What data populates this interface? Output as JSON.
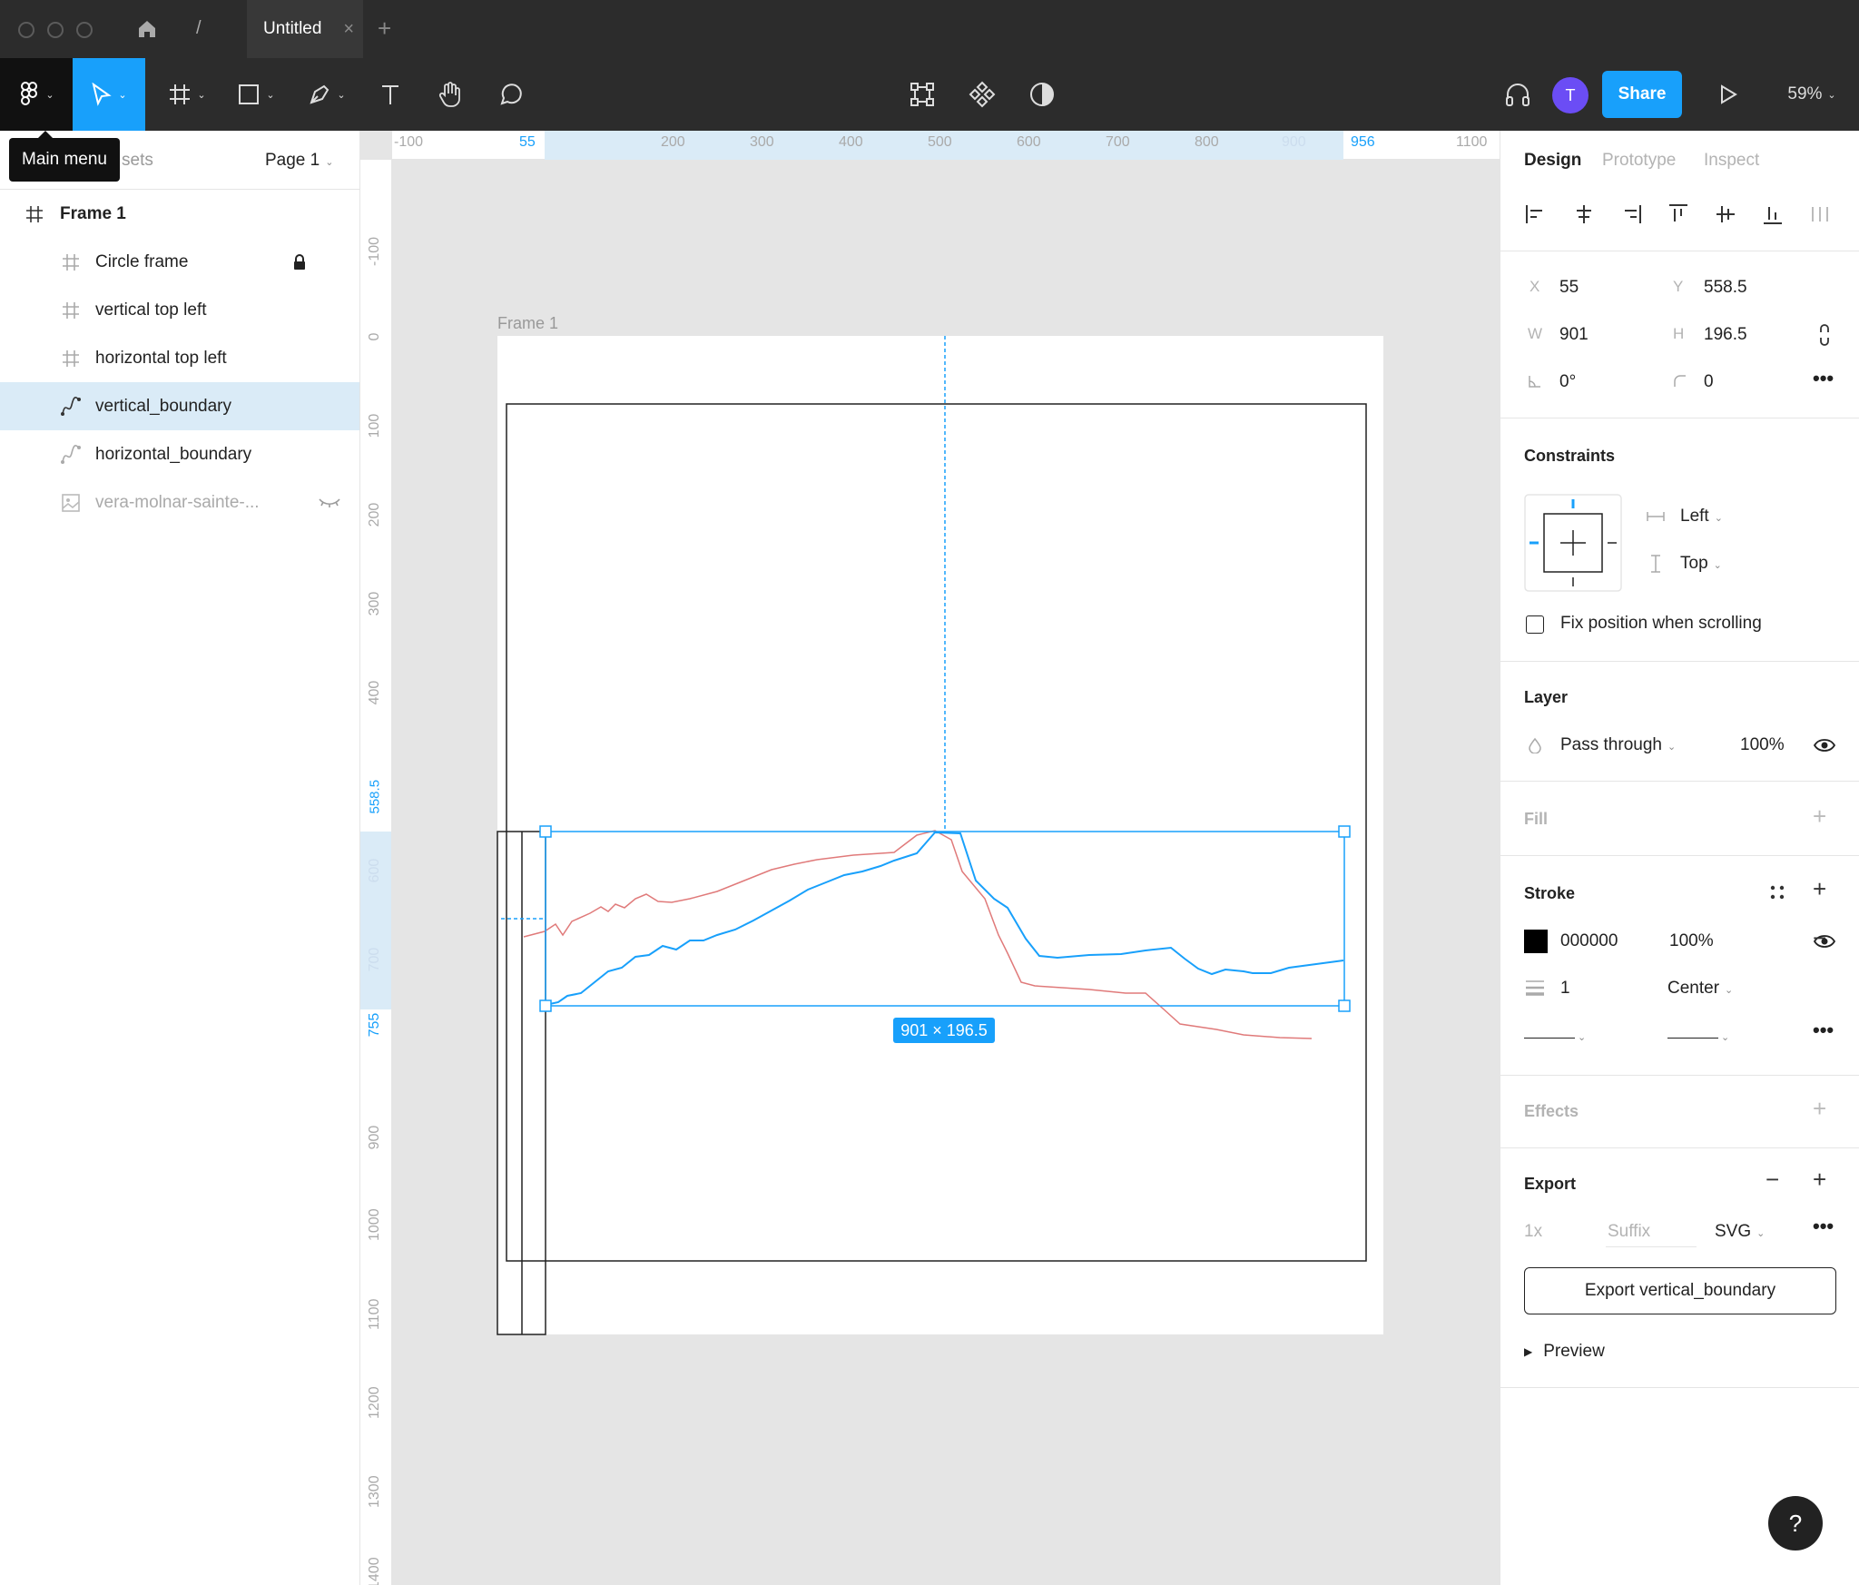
{
  "tab": {
    "title": "Untitled",
    "close": "×",
    "add": "+",
    "path_sep": "/"
  },
  "toolbar": {
    "share_label": "Share",
    "avatar_initial": "T",
    "zoom": "59%"
  },
  "tooltip": {
    "text": "Main menu"
  },
  "left_panel": {
    "assets_tab_partial": "sets",
    "page_selector": "Page 1",
    "layers": [
      {
        "name": "Frame 1",
        "icon": "frame-icon"
      },
      {
        "name": "Circle frame",
        "icon": "frame-icon",
        "locked": true
      },
      {
        "name": "vertical top left",
        "icon": "frame-icon"
      },
      {
        "name": "horizontal top left",
        "icon": "frame-icon"
      },
      {
        "name": "vertical_boundary",
        "icon": "vector-icon",
        "selected": true
      },
      {
        "name": "horizontal_boundary",
        "icon": "vector-icon"
      },
      {
        "name": "vera-molnar-sainte-...",
        "icon": "image-icon",
        "hidden": true
      }
    ]
  },
  "rulers": {
    "top": [
      "-100",
      "55",
      "200",
      "300",
      "400",
      "500",
      "600",
      "700",
      "800",
      "900",
      "956",
      "1100"
    ],
    "left": [
      "-100",
      "0",
      "100",
      "200",
      "300",
      "400",
      "558.5",
      "600",
      "700",
      "755",
      "900",
      "1000",
      "1100",
      "1200",
      "1300",
      "1400"
    ]
  },
  "canvas": {
    "frame_label": "Frame 1",
    "dimension_badge": "901 × 196.5"
  },
  "right_panel": {
    "tabs": [
      "Design",
      "Prototype",
      "Inspect"
    ],
    "x_label": "X",
    "x_value": "55",
    "y_label": "Y",
    "y_value": "558.5",
    "w_label": "W",
    "w_value": "901",
    "h_label": "H",
    "h_value": "196.5",
    "rotation_value": "0°",
    "radius_value": "0",
    "constraints": {
      "title": "Constraints",
      "horizontal": "Left",
      "vertical": "Top",
      "fix_label": "Fix position when scrolling"
    },
    "layer": {
      "title": "Layer",
      "blend": "Pass through",
      "opacity": "100%"
    },
    "fill": {
      "title": "Fill"
    },
    "stroke": {
      "title": "Stroke",
      "color": "000000",
      "opacity": "100%",
      "weight": "1",
      "align": "Center"
    },
    "effects": {
      "title": "Effects"
    },
    "export": {
      "title": "Export",
      "scale": "1x",
      "suffix_placeholder": "Suffix",
      "format": "SVG",
      "button": "Export vertical_boundary",
      "preview": "Preview"
    }
  },
  "help": {
    "label": "?"
  },
  "colors": {
    "accent": "#18a0fb",
    "selection_line": "#18a0fb",
    "red_line": "#e07a7a",
    "toolbar_bg": "#2c2c2c"
  }
}
